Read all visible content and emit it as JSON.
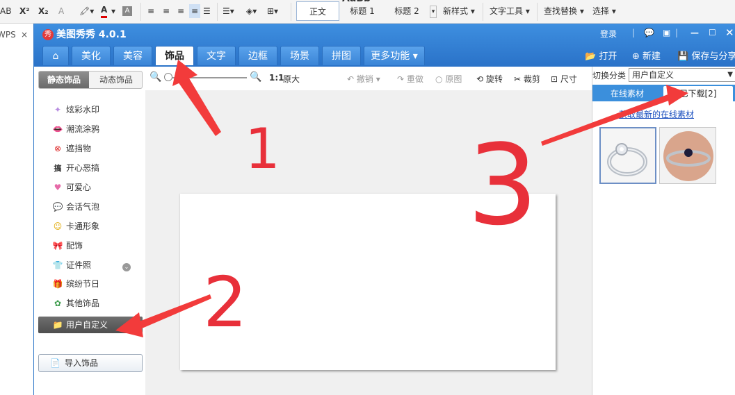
{
  "wps_toolbar": {
    "items": [
      "AB",
      "X²",
      "X₂",
      "A",
      "A"
    ],
    "styles": [
      "正文",
      "标题 1",
      "标题 2"
    ],
    "style_preview": "AaBb",
    "new_style": "新样式",
    "text_tools": "文字工具",
    "find_replace": "查找替换",
    "select": "选择"
  },
  "wps_tab": {
    "label": "WPS",
    "close": "×"
  },
  "app": {
    "title": "美图秀秀 4.0.1",
    "logo": "秀",
    "login": "登录",
    "tabs": [
      "美化",
      "美容",
      "饰品",
      "文字",
      "边框",
      "场景",
      "拼图",
      "更多功能"
    ],
    "active_tab": "饰品",
    "actions": {
      "open": "打开",
      "new": "新建",
      "save": "保存与分享"
    }
  },
  "left_panel": {
    "segments": [
      "静态饰品",
      "动态饰品"
    ],
    "categories": [
      {
        "label": "炫彩水印",
        "icon": "✦"
      },
      {
        "label": "潮流涂鸦",
        "icon": "👄"
      },
      {
        "label": "遮挡物",
        "icon": "⊗"
      },
      {
        "label": "开心恶搞",
        "icon": "搞"
      },
      {
        "label": "可爱心",
        "icon": "♥"
      },
      {
        "label": "会话气泡",
        "icon": "💬"
      },
      {
        "label": "卡通形象",
        "icon": "☺"
      },
      {
        "label": "配饰",
        "icon": "🎀"
      },
      {
        "label": "证件照",
        "icon": "👕"
      },
      {
        "label": "缤纷节日",
        "icon": "🎁"
      },
      {
        "label": "其他饰品",
        "icon": "✿"
      }
    ],
    "selected_category": {
      "label": "用户自定义",
      "icon": "📁"
    },
    "import_button": "导入饰品"
  },
  "center_tools": {
    "original_size": "原大",
    "ratio": "1:1",
    "undo": "撤销",
    "redo": "重做",
    "original": "原图",
    "rotate": "旋转",
    "crop": "裁剪",
    "size": "尺寸"
  },
  "right_panel": {
    "switch_label": "切换分类",
    "category_value": "用户自定义",
    "tabs": [
      "在线素材",
      "已下载[2]"
    ],
    "active_tab": "已下载[2]",
    "link": "获取最新的在线素材"
  },
  "annotations": [
    "1",
    "2",
    "3"
  ],
  "colors": {
    "title_bar": "#3e8fe0",
    "accent_arrow": "#f23b3b",
    "annotation_ink": "#e8303a"
  }
}
